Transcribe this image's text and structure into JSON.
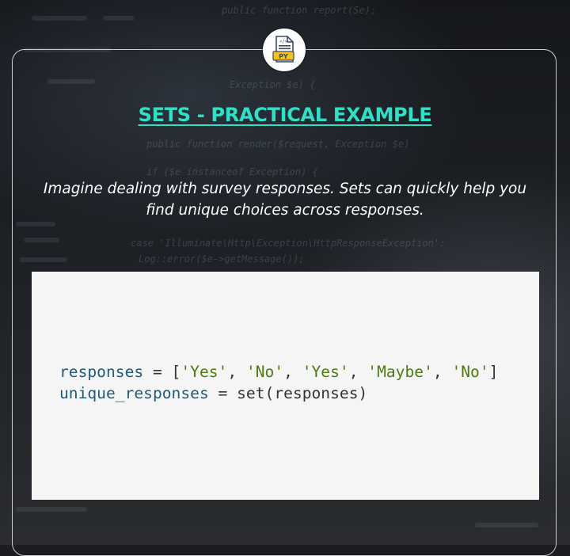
{
  "header": {
    "badge_icon": "python-file-icon",
    "badge_label": "PY",
    "title": "SETS - PRACTICAL EXAMPLE"
  },
  "intro": {
    "text": "Imagine dealing with survey responses. Sets can quickly help you find unique choices across responses."
  },
  "code": {
    "line1": {
      "var": "responses",
      "op": " = [",
      "items": [
        "'Yes'",
        "'No'",
        "'Yes'",
        "'Maybe'",
        "'No'"
      ],
      "sep": ", ",
      "close": "]"
    },
    "line2": {
      "var": "unique_responses",
      "op": " = set(responses)"
    }
  },
  "colors": {
    "title": "#2fe0c6",
    "code_background": "#f5f5f5",
    "code_variable": "#1f5a78",
    "code_string": "#4e7a10"
  }
}
